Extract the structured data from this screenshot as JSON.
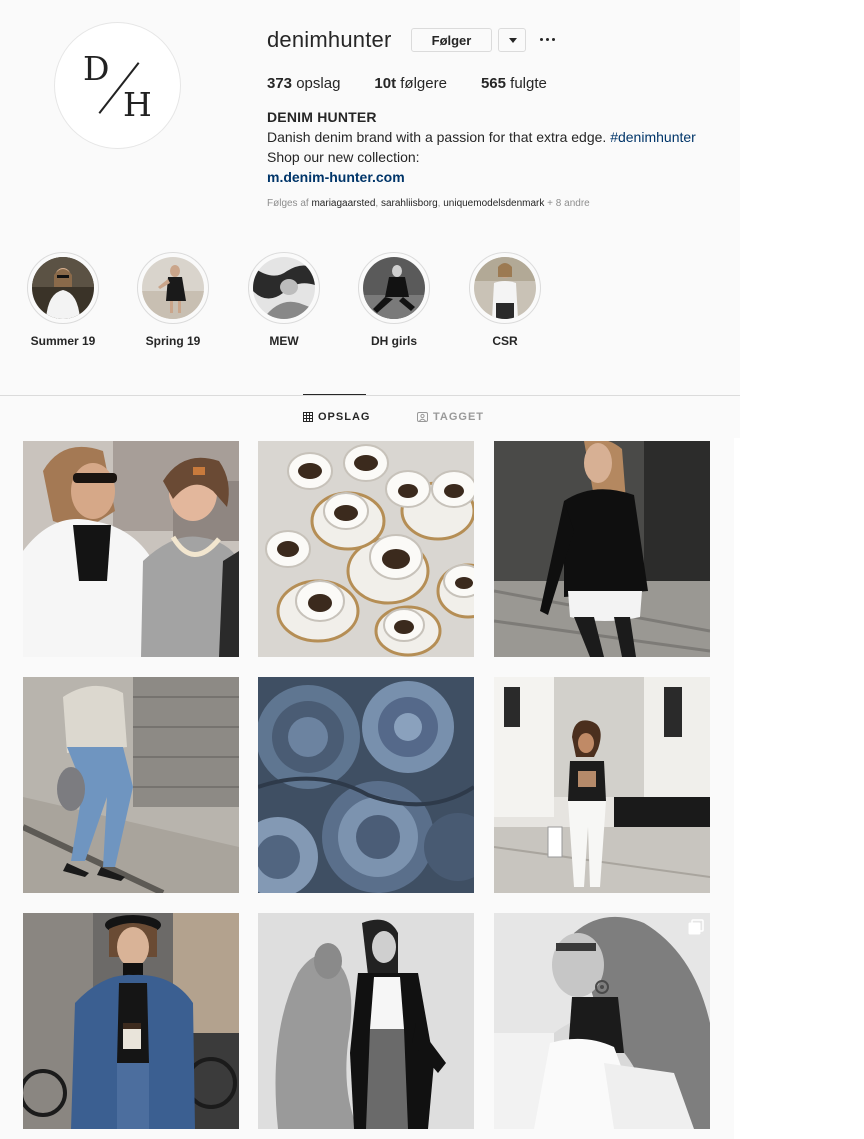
{
  "profile": {
    "username": "denimhunter",
    "follow_label": "Følger",
    "avatar_letters": {
      "top": "D",
      "bottom": "H"
    },
    "stats": {
      "posts_count": "373",
      "posts_label": "opslag",
      "followers_count": "10t",
      "followers_label": "følgere",
      "following_count": "565",
      "following_label": "fulgte"
    },
    "full_name": "DENIM HUNTER",
    "bio_line1": "Danish denim brand with a passion for that extra edge.",
    "bio_hashtag": "#denimhunter",
    "bio_line2": "Shop our new collection:",
    "bio_link": "m.denim-hunter.com",
    "followed_by_prefix": "Følges af",
    "followed_by_accounts": [
      "mariagaarsted",
      "sarahliisborg",
      "uniquemodelsdenmark"
    ],
    "followed_by_suffix": "+ 8 andre"
  },
  "highlights": [
    {
      "label": "Summer 19"
    },
    {
      "label": "Spring 19"
    },
    {
      "label": "MEW"
    },
    {
      "label": "DH girls"
    },
    {
      "label": "CSR"
    }
  ],
  "tabs": {
    "posts_label": "OPSLAG",
    "tagged_label": "TAGGET"
  },
  "posts": [
    {
      "subject": "two women talking on street"
    },
    {
      "subject": "empty coffee cups"
    },
    {
      "subject": "woman in black leather jacket"
    },
    {
      "subject": "woman walking in jeans"
    },
    {
      "subject": "folded denim close-up"
    },
    {
      "subject": "woman in white jeans on street"
    },
    {
      "subject": "woman in denim jacket with beret"
    },
    {
      "subject": "black and white woman with shadow"
    },
    {
      "subject": "black and white woman profile"
    }
  ],
  "colors": {
    "link": "#003569",
    "text": "#262626",
    "muted": "#8e8e8e",
    "border": "#dbdbdb",
    "background": "#fafafa"
  },
  "icons": {
    "dropdown": "chevron-down-icon",
    "more": "more-dots-icon",
    "posts_tab": "grid-icon",
    "tagged_tab": "tag-portrait-icon",
    "carousel": "multiple-images-icon"
  }
}
